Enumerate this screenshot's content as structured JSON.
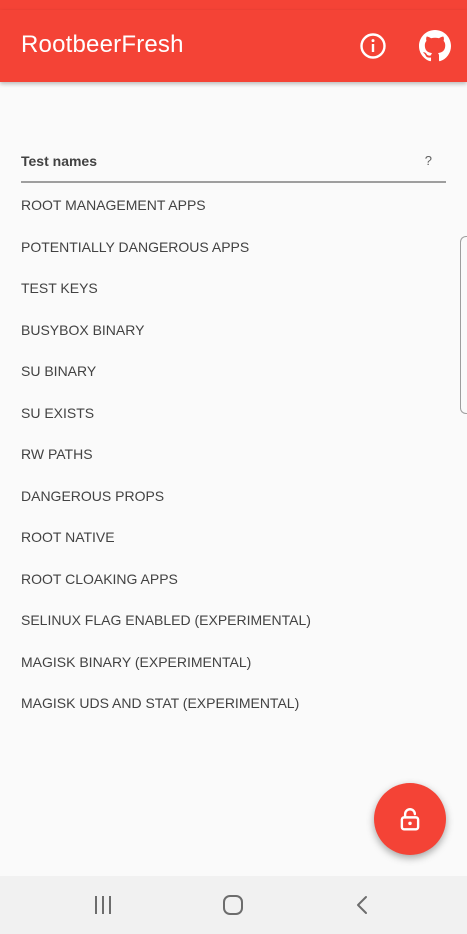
{
  "app": {
    "title": "RootbeerFresh",
    "accent_color": "#f44336",
    "info_icon": "info-icon",
    "github_icon": "github-icon"
  },
  "table": {
    "header_label": "Test names",
    "header_result": "?",
    "tests": [
      "ROOT MANAGEMENT APPS",
      "POTENTIALLY DANGEROUS APPS",
      "TEST KEYS",
      "BUSYBOX BINARY",
      "SU BINARY",
      "SU EXISTS",
      "RW PATHS",
      "DANGEROUS PROPS",
      "ROOT NATIVE",
      "ROOT CLOAKING APPS",
      "SELINUX FLAG ENABLED (EXPERIMENTAL)",
      "MAGISK BINARY (EXPERIMENTAL)",
      "MAGISK UDS AND STAT (EXPERIMENTAL)"
    ]
  },
  "fab": {
    "icon": "unlock-icon"
  },
  "nav": {
    "recents_icon": "recents-icon",
    "home_icon": "home-icon",
    "back_icon": "back-icon"
  }
}
